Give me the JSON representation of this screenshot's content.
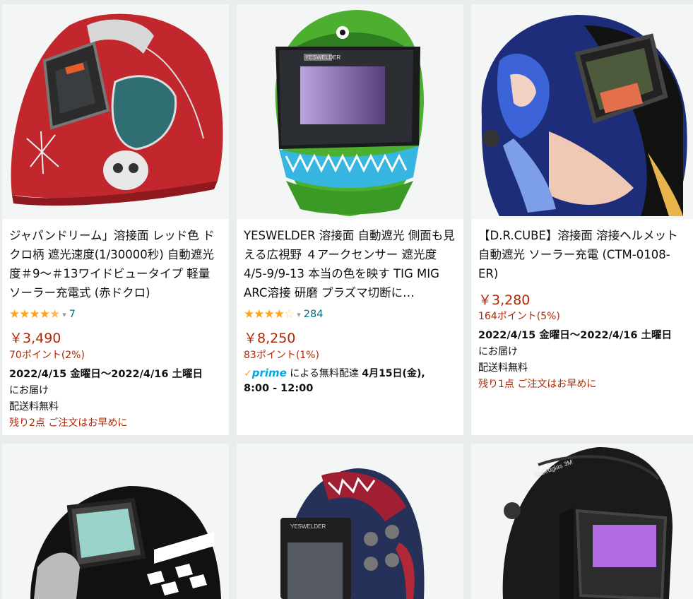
{
  "products": [
    {
      "title": "ジャパンドリーム」溶接面 レッド色 ドクロ柄 遮光速度(1/30000秒) 自動遮光度＃9～＃13ワイドビュータイプ 軽量 ソーラー充電式 (赤ドクロ)",
      "rating_stars": 4.5,
      "rating_count": "7",
      "price": "￥3,490",
      "points": "70ポイント(2%)",
      "delivery": "2022/4/15 金曜日～2022/4/16 土曜日",
      "delivery_suffix": "にお届け",
      "shipping": "配送料無料",
      "stock": "残り2点 ご注文はお早めに",
      "image_icon": "red-skull-welding-helmet"
    },
    {
      "title": "YESWELDER 溶接面 自動遮光 側面も見える広視野 ４アークセンサー 遮光度4/5-9/9-13 本当の色を映す TIG MIG ARC溶接 研磨 プラズマ切断に…",
      "rating_stars": 4,
      "rating_count": "284",
      "price": "￥8,250",
      "points": "83ポイント(1%)",
      "prime_label": "prime",
      "prime_text": "による無料配達",
      "prime_date": "4月15日(金),",
      "prime_time": "8:00 - 12:00",
      "helmet_brand": "YESWELDER",
      "image_icon": "green-monster-welding-helmet"
    },
    {
      "title": "【D.R.CUBE】溶接面 溶接ヘルメット 自動遮光 ソーラー充電 (CTM-0108-ER)",
      "price": "￥3,280",
      "points": "164ポイント(5%)",
      "delivery": "2022/4/15 金曜日～2022/4/16 土曜日",
      "delivery_suffix": "にお届け",
      "shipping": "配送料無料",
      "stock": "残り1点 ご注文はお早めに",
      "image_icon": "anime-art-welding-helmet"
    },
    {
      "image_icon": "black-checkered-welding-helmet"
    },
    {
      "helmet_brand": "YESWELDER",
      "image_icon": "venom-art-welding-helmet"
    },
    {
      "helmet_brand": "Speedglas 3M",
      "image_icon": "black-speedglas-welding-helmet"
    }
  ],
  "colors": {
    "price": "#b12704",
    "star": "#ffa41c",
    "link": "#007185",
    "prime": "#00a8e1"
  }
}
